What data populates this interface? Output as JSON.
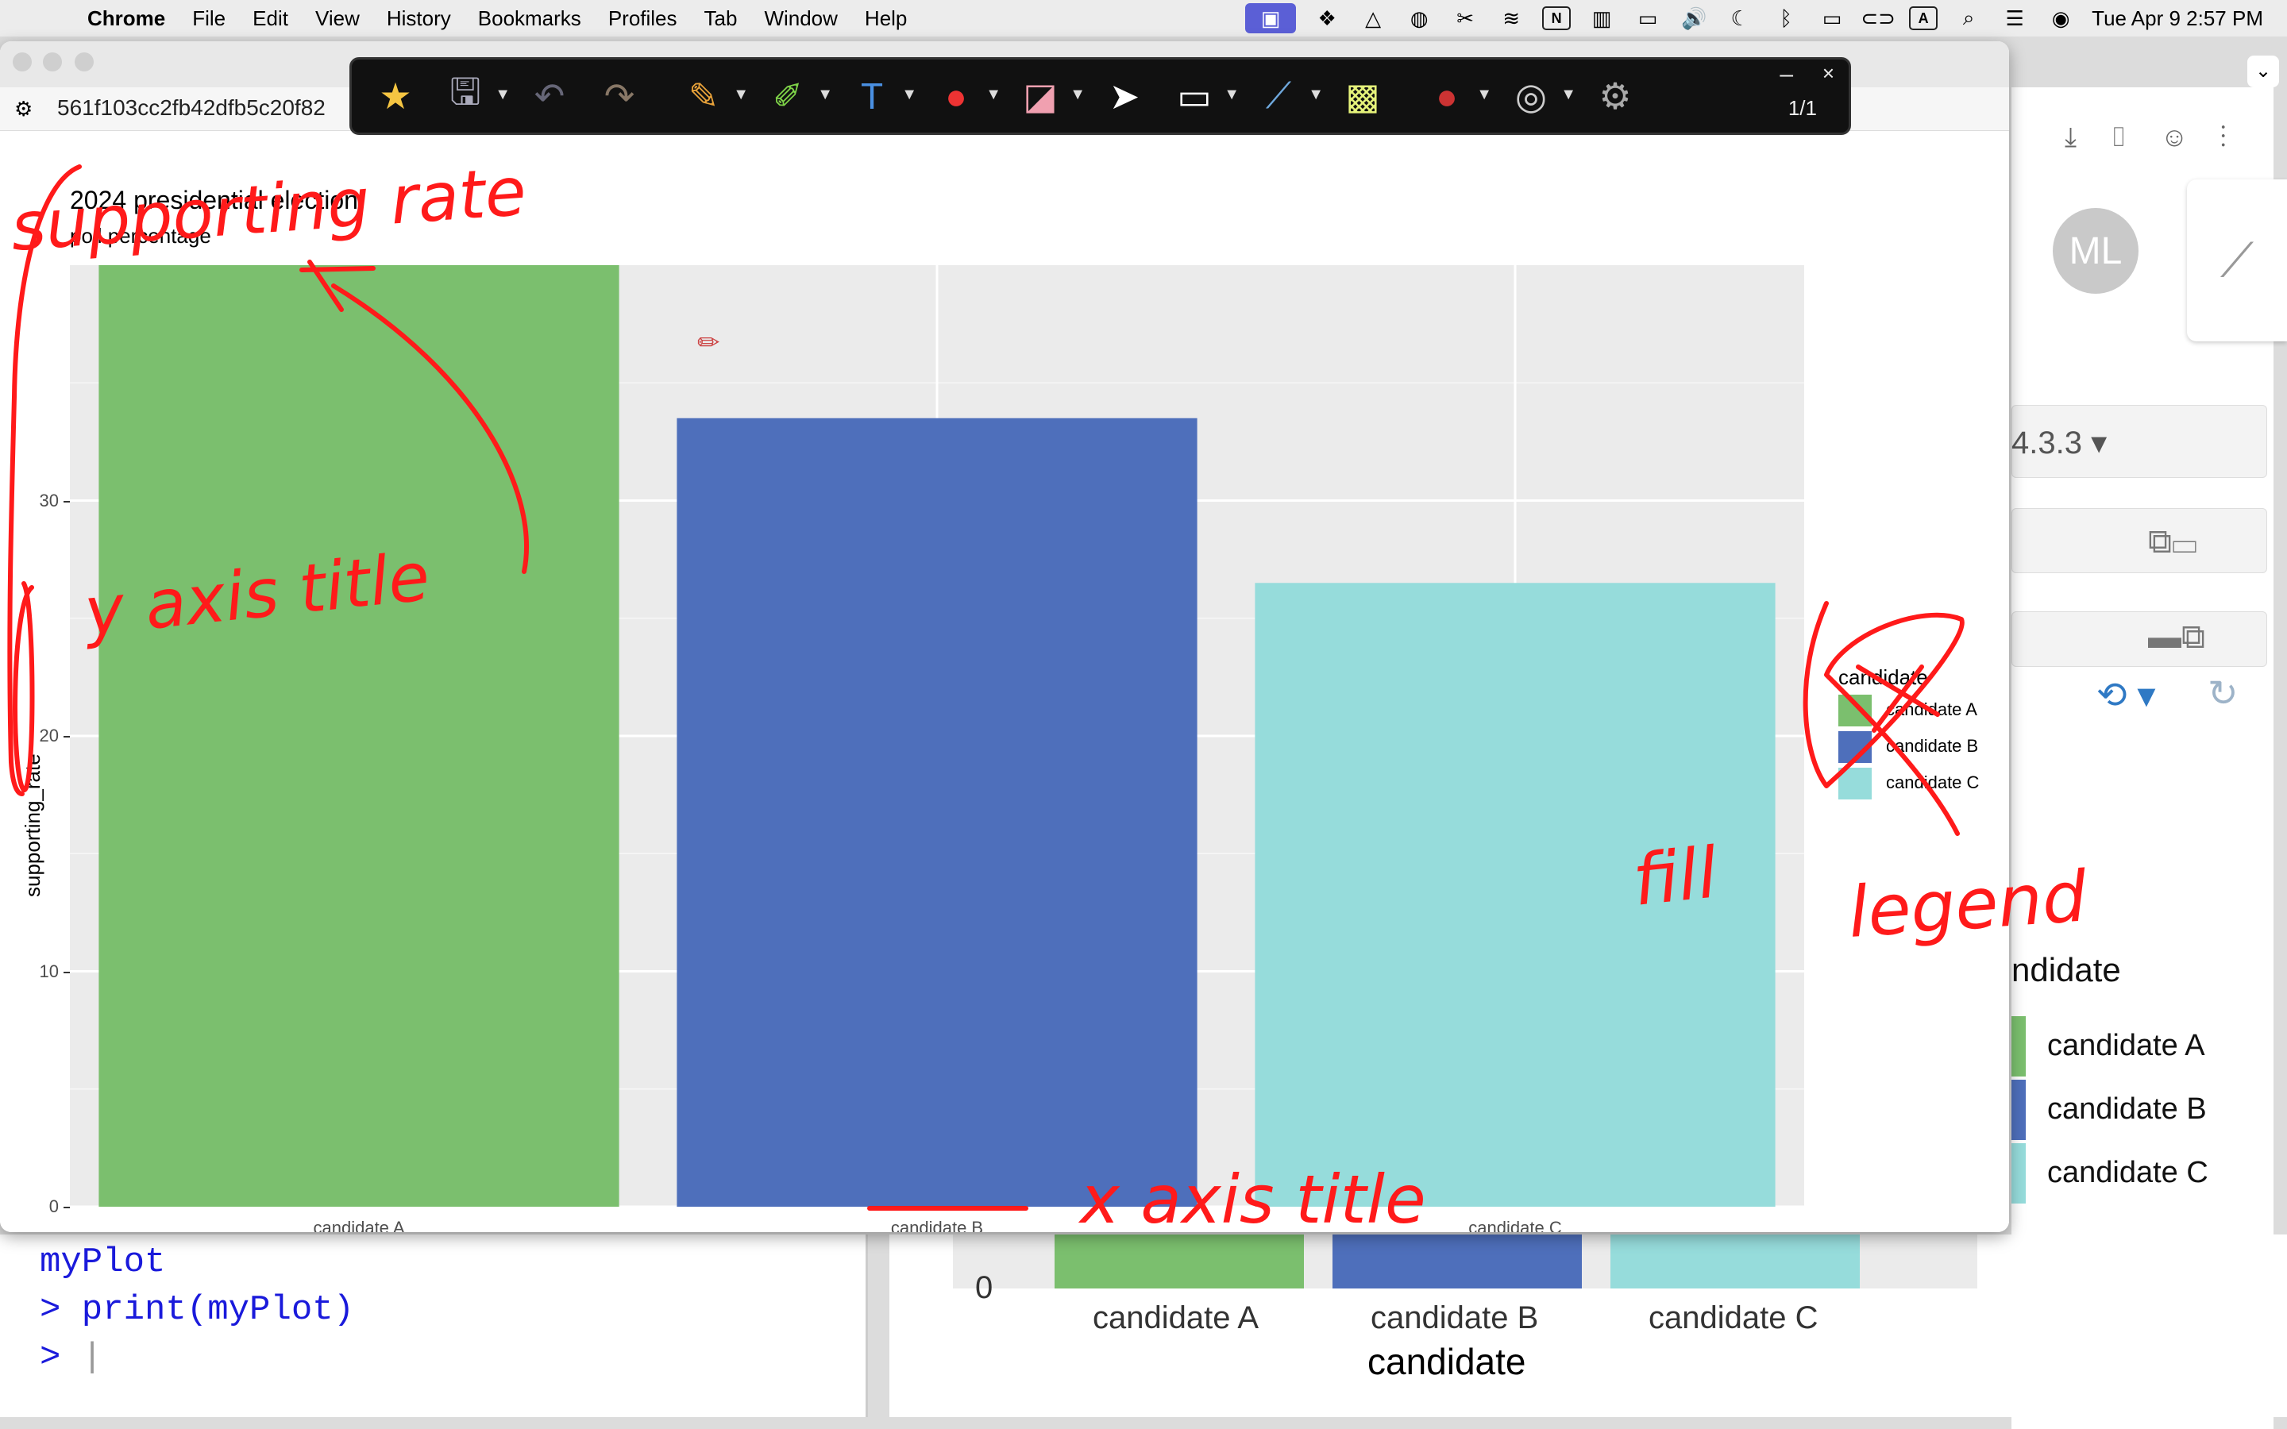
{
  "menubar": {
    "app": "Chrome",
    "items": [
      "File",
      "Edit",
      "View",
      "History",
      "Bookmarks",
      "Profiles",
      "Tab",
      "Window",
      "Help"
    ],
    "clock": "Tue Apr 9  2:57 PM",
    "input_badge": "A",
    "notion_badge": "N"
  },
  "browser": {
    "url": "561f103cc2fb42dfb5c20f82"
  },
  "toolbar": {
    "page_indicator": "1/1",
    "minimize": "–",
    "close": "×"
  },
  "background": {
    "avatar_initials": "ML",
    "version": "4.3.3",
    "legend_title_partial": "ndidate",
    "legend_items": [
      "candidate A",
      "candidate B",
      "candidate C"
    ],
    "console_lines": [
      "myPlot",
      "> print(myPlot)",
      "> "
    ],
    "axis_zero": "0",
    "x_ticks": [
      "candidate A",
      "candidate B",
      "candidate C"
    ],
    "x_title": "candidate"
  },
  "chart_data": {
    "type": "bar",
    "title": "2024 presidential election",
    "subtitle": "poll percentage",
    "xlabel": "candidate",
    "ylabel": "supporting_rate",
    "categories": [
      "candidate A",
      "candidate B",
      "candidate C"
    ],
    "values": [
      40,
      33.5,
      26.5
    ],
    "colors": [
      "#7bbf6e",
      "#4e6fbb",
      "#96dcdb"
    ],
    "yticks": [
      0,
      10,
      20,
      30
    ],
    "ylim": [
      0,
      40
    ],
    "legend_title": "candidate",
    "legend_position": "right",
    "panel_color": "#ebebeb",
    "grid": true
  },
  "annotations": {
    "ink_color": "#ff1a1a",
    "notes": [
      "supporting rate",
      "y axis title",
      "x axis title",
      "fill",
      "legend"
    ]
  }
}
